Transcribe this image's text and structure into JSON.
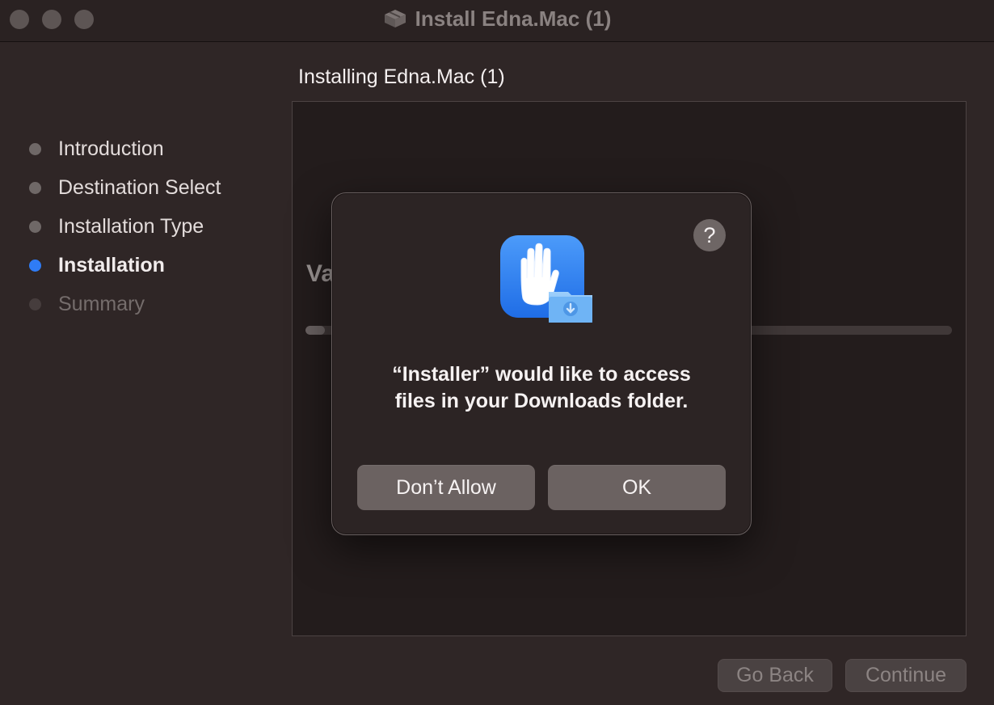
{
  "window": {
    "title": "Install Edna.Mac (1)"
  },
  "sidebar": {
    "steps": [
      {
        "label": "Introduction",
        "state": "done"
      },
      {
        "label": "Destination Select",
        "state": "done"
      },
      {
        "label": "Installation Type",
        "state": "done"
      },
      {
        "label": "Installation",
        "state": "active"
      },
      {
        "label": "Summary",
        "state": "future"
      }
    ]
  },
  "content": {
    "heading": "Installing Edna.Mac (1)",
    "status_partial": "Va",
    "progress": 0.03
  },
  "footer": {
    "go_back": "Go Back",
    "continue": "Continue"
  },
  "dialog": {
    "help_symbol": "?",
    "icon": "privacy-hand-icon",
    "message_line1": "“Installer” would like to access",
    "message_line2": "files in your Downloads folder.",
    "dont_allow": "Don’t Allow",
    "ok": "OK"
  },
  "colors": {
    "accent": "#2f7cf6",
    "icon_blue": "#3d8ef7"
  }
}
